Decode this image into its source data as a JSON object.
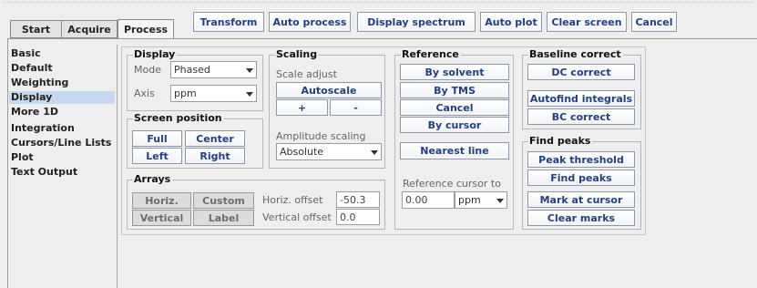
{
  "tabs": [
    "Start",
    "Acquire",
    "Process"
  ],
  "toolbar": {
    "transform": "Transform",
    "auto_process": "Auto process",
    "display_spectrum": "Display spectrum",
    "auto_plot": "Auto plot",
    "clear_screen": "Clear screen",
    "cancel": "Cancel"
  },
  "sidebar": {
    "items": [
      "Basic",
      "Default",
      "Weighting",
      "Display",
      "More 1D",
      "Integration",
      "Cursors/Line Lists",
      "Plot",
      "Text Output"
    ],
    "selected": "Display"
  },
  "display": {
    "title": "Display",
    "mode_label": "Mode",
    "mode_value": "Phased",
    "axis_label": "Axis",
    "axis_value": "ppm"
  },
  "screen_position": {
    "title": "Screen position",
    "full": "Full",
    "center": "Center",
    "left": "Left",
    "right": "Right"
  },
  "arrays": {
    "title": "Arrays",
    "horiz": "Horiz.",
    "custom": "Custom",
    "vertical": "Vertical",
    "label": "Label",
    "horiz_offset_label": "Horiz. offset",
    "horiz_offset_value": "-50.3",
    "vertical_offset_label": "Vertical offset",
    "vertical_offset_value": "0.0"
  },
  "scaling": {
    "title": "Scaling",
    "scale_adjust_label": "Scale adjust",
    "autoscale": "Autoscale",
    "plus": "+",
    "minus": "-",
    "amplitude_label": "Amplitude scaling",
    "amplitude_value": "Absolute"
  },
  "reference": {
    "title": "Reference",
    "by_solvent": "By solvent",
    "by_tms": "By TMS",
    "cancel": "Cancel",
    "by_cursor": "By cursor",
    "nearest_line": "Nearest line",
    "cursor_to_label": "Reference cursor to",
    "cursor_to_value": "0.00",
    "cursor_to_unit": "ppm"
  },
  "baseline": {
    "title": "Baseline correct",
    "dc_correct": "DC correct",
    "autofind": "Autofind integrals",
    "bc_correct": "BC correct"
  },
  "find_peaks": {
    "title": "Find peaks",
    "peak_threshold": "Peak threshold",
    "find_peaks": "Find peaks",
    "mark_at_cursor": "Mark at cursor",
    "clear_marks": "Clear marks"
  }
}
